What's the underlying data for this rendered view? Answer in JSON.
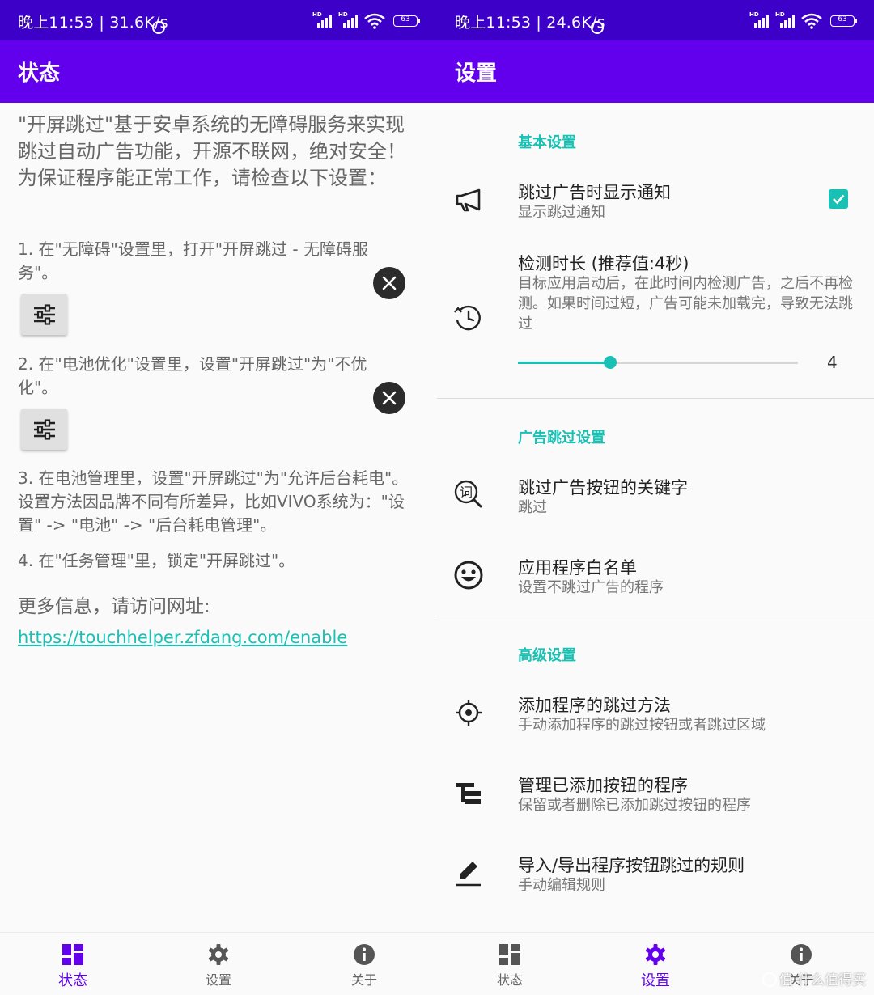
{
  "colors": {
    "status_bar": "#3d00c9",
    "toolbar": "#6200ee",
    "accent": "#19c1b4",
    "nav_active": "#6200ee",
    "text_secondary": "#666666"
  },
  "left": {
    "status_bar": {
      "time": "晚上11:53 | 31.6K/s",
      "battery": "63"
    },
    "toolbar_title": "状态",
    "intro": "\"开屏跳过\"基于安卓系统的无障碍服务来实现跳过自动广告功能，开源不联网，绝对安全！为保证程序能正常工作，请检查以下设置：",
    "steps": [
      {
        "text": "1. 在\"无障碍\"设置里，打开\"开屏跳过 - 无障碍服务\"。",
        "status_icon": "close-icon",
        "action_icon": "tune-icon"
      },
      {
        "text": "2. 在\"电池优化\"设置里，设置\"开屏跳过\"为\"不优化\"。",
        "status_icon": "close-icon",
        "action_icon": "tune-icon"
      },
      {
        "text": "3. 在电池管理里，设置\"开屏跳过\"为\"允许后台耗电\"。设置方法因品牌不同有所差异，比如VIVO系统为：\"设置\" -> \"电池\" -> \"后台耗电管理\"。"
      },
      {
        "text": "4. 在\"任务管理\"里，锁定\"开屏跳过\"。"
      }
    ],
    "more_info": "更多信息，请访问网址:",
    "link": "https://touchhelper.zfdang.com/enable",
    "nav": [
      {
        "label": "状态",
        "icon": "dashboard-icon",
        "active": true
      },
      {
        "label": "设置",
        "icon": "gear-icon",
        "active": false
      },
      {
        "label": "关于",
        "icon": "info-icon",
        "active": false
      }
    ]
  },
  "right": {
    "status_bar": {
      "time": "晚上11:53 | 24.6K/s",
      "battery": "63"
    },
    "toolbar_title": "设置",
    "categories": {
      "basic": "基本设置",
      "ad_skip": "广告跳过设置",
      "advanced": "高级设置"
    },
    "prefs": {
      "notify": {
        "title": "跳过广告时显示通知",
        "summary": "显示跳过通知",
        "checked": true,
        "icon": "megaphone-icon"
      },
      "duration": {
        "title": "检测时长 (推荐值:4秒)",
        "summary": "目标应用启动后，在此时间内检测广告，之后不再检测。如果时间过短，广告可能未加载完，导致无法跳过",
        "value": "4",
        "value_fraction": 0.33,
        "icon": "timer-icon"
      },
      "keyword": {
        "title": "跳过广告按钮的关键字",
        "summary": "跳过",
        "icon": "keyword-search-icon"
      },
      "whitelist": {
        "title": "应用程序白名单",
        "summary": "设置不跳过广告的程序",
        "icon": "smiley-icon"
      },
      "add_method": {
        "title": "添加程序的跳过方法",
        "summary": "手动添加程序的跳过按钮或者跳过区域",
        "icon": "crosshair-icon"
      },
      "manage": {
        "title": "管理已添加按钮的程序",
        "summary": "保留或者删除已添加跳过按钮的程序",
        "icon": "tree-list-icon"
      },
      "import_export": {
        "title": "导入/导出程序按钮跳过的规则",
        "summary": "手动编辑规则",
        "icon": "pencil-icon"
      }
    },
    "nav": [
      {
        "label": "状态",
        "icon": "dashboard-icon",
        "active": false
      },
      {
        "label": "设置",
        "icon": "gear-icon",
        "active": true
      },
      {
        "label": "关于",
        "icon": "info-icon",
        "active": false
      }
    ],
    "watermark": "值 什么值得买"
  }
}
